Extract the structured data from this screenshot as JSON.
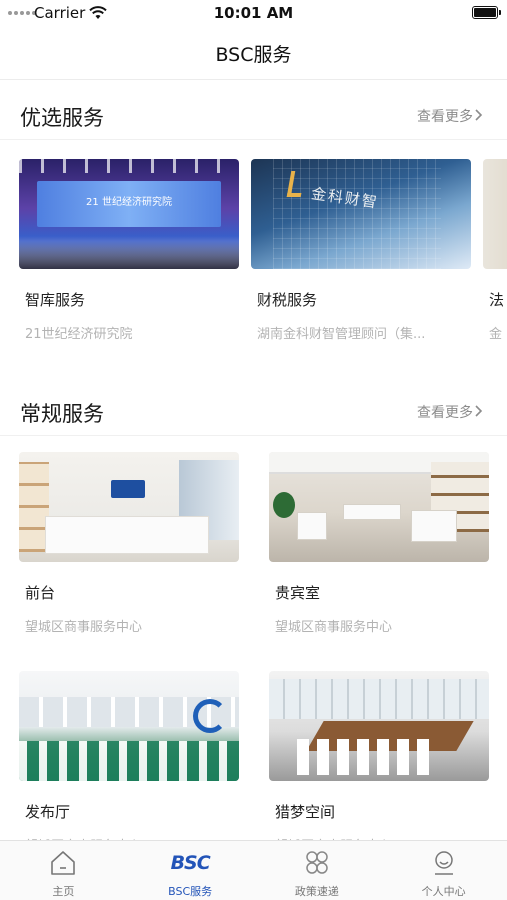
{
  "status_bar": {
    "carrier": "Carrier",
    "time": "10:01 AM",
    "battery_level": 1.0
  },
  "nav": {
    "title": "BSC服务"
  },
  "featured": {
    "title": "优选服务",
    "more_label": "查看更多",
    "items": [
      {
        "title": "智库服务",
        "subtitle": "21世纪经济研究院",
        "image_caption": "21 世纪经济研究院"
      },
      {
        "title": "财税服务",
        "subtitle": "湖南金科财智管理顾问（集...",
        "image_caption": "金科财智"
      },
      {
        "title": "法",
        "subtitle": "金"
      }
    ]
  },
  "regular": {
    "title": "常规服务",
    "more_label": "查看更多",
    "items": [
      {
        "title": "前台",
        "subtitle": "望城区商事服务中心"
      },
      {
        "title": "贵宾室",
        "subtitle": "望城区商事服务中心"
      },
      {
        "title": "发布厅",
        "subtitle": "望城区商事服务中心"
      },
      {
        "title": "猎梦空间",
        "subtitle": "望城区商事服务中心"
      }
    ]
  },
  "tabs": [
    {
      "label": "主页",
      "icon": "home-icon",
      "active": false
    },
    {
      "label": "BSC服务",
      "icon": "bsc-logo-icon",
      "logo_text": "BSC",
      "active": true
    },
    {
      "label": "政策速递",
      "icon": "grid-icon",
      "active": false
    },
    {
      "label": "个人中心",
      "icon": "user-icon",
      "active": false
    }
  ],
  "colors": {
    "accent": "#2354b8",
    "inactive_tab": "#777777",
    "subtitle": "#b3b3b3",
    "more_link": "#8c8c8c"
  }
}
